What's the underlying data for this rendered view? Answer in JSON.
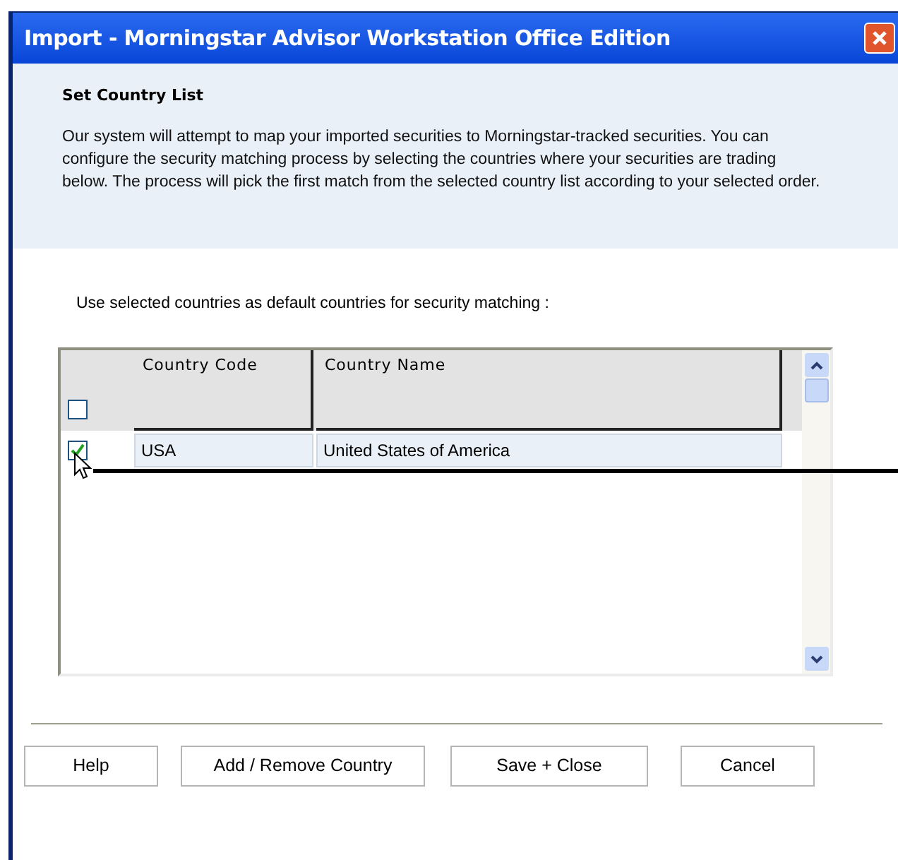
{
  "window": {
    "title": "Import - Morningstar Advisor Workstation Office Edition"
  },
  "header": {
    "title": "Set Country List",
    "description": "Our system will attempt to map your imported securities to Morningstar-tracked securities.  You can configure the security matching process by selecting the countries where your securities are trading below.  The process will pick the first match from the selected country list according to your selected order."
  },
  "prompt": "Use selected countries as default countries for security matching :",
  "table": {
    "select_all": {
      "checked": false
    },
    "columns": [
      "Country Code",
      "Country Name"
    ],
    "rows": [
      {
        "checked": true,
        "cells": [
          "USA",
          "United States of America"
        ]
      }
    ]
  },
  "buttons": [
    "Help",
    "Add / Remove Country",
    "Save + Close",
    "Cancel"
  ]
}
